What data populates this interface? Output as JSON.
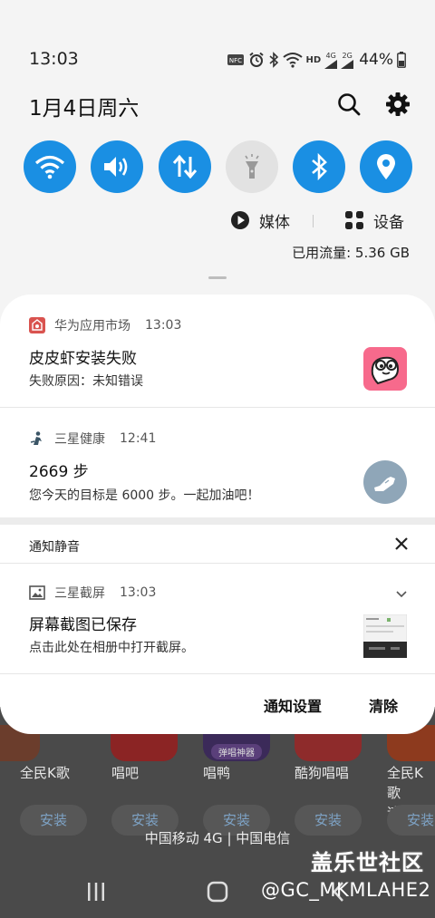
{
  "status_bar": {
    "time": "13:03",
    "network_labels": [
      "HD",
      "4G",
      "2G"
    ],
    "battery": "44%",
    "icons": [
      "nfc-icon",
      "alarm-icon",
      "bluetooth-icon",
      "wifi-icon",
      "signal-icon",
      "battery-icon"
    ]
  },
  "header": {
    "date": "1月4日周六",
    "icons": [
      "search-icon",
      "settings-gear-icon"
    ]
  },
  "quick_settings": {
    "toggles": [
      {
        "name": "wifi",
        "on": true
      },
      {
        "name": "sound",
        "on": true
      },
      {
        "name": "mobile-data",
        "on": true
      },
      {
        "name": "flashlight",
        "on": false
      },
      {
        "name": "bluetooth",
        "on": true
      },
      {
        "name": "location",
        "on": true
      }
    ],
    "accent_color": "#1a8fe3"
  },
  "media": {
    "label": "媒体"
  },
  "devices": {
    "label": "设备"
  },
  "data_usage": "已用流量: 5.36 GB",
  "notifications": [
    {
      "app": "华为应用市场",
      "time": "13:03",
      "title": "皮皮虾安装失败",
      "body": "失败原因：未知错误"
    },
    {
      "app": "三星健康",
      "time": "12:41",
      "title": "2669 步",
      "body": "您今天的目标是 6000 步。一起加油吧！"
    }
  ],
  "silent_section": {
    "label": "通知静音",
    "notifications": [
      {
        "app": "三星截屏",
        "time": "13:03",
        "title": "屏幕截图已保存",
        "body": "点击此处在相册中打开截屏。"
      }
    ]
  },
  "footer": {
    "settings_label": "通知设置",
    "clear_label": "清除"
  },
  "background_app": {
    "tile_tag": "弹唱神器",
    "apps": [
      "全民K歌",
      "唱吧",
      "唱鸭",
      "酷狗唱唱",
      "全民K歌\n速版"
    ],
    "install_label": "安装",
    "carrier": "中国移动 4G | 中国电信"
  },
  "watermark": {
    "brand": "盖乐世社区",
    "user": "@GC_MKMLAHE2"
  }
}
